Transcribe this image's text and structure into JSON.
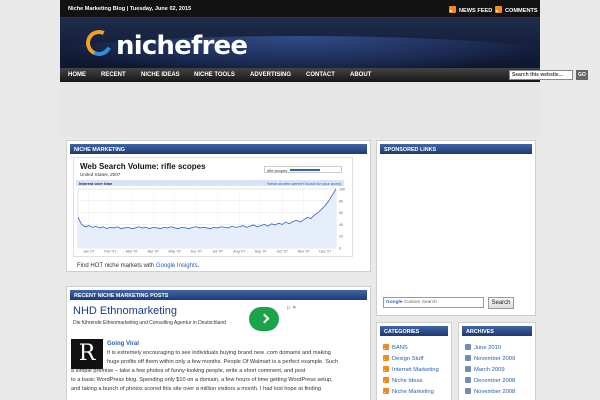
{
  "topbar": {
    "blog_date": "Niche Marketing Blog | Tuesday, June 02, 2015",
    "news_feed": "NEWS FEED",
    "comments": "COMMENTS"
  },
  "header": {
    "logo_text": "nichefree"
  },
  "nav": {
    "items": [
      "HOME",
      "RECENT",
      "NICHE IDEAS",
      "NICHE TOOLS",
      "ADVERTISING",
      "CONTACT",
      "ABOUT"
    ],
    "search_placeholder": "Search this website...",
    "go_label": "GO"
  },
  "niche_marketing": {
    "heading": "NICHE MARKETING",
    "chart_title": "Web Search Volume: rifle scopes",
    "chart_subtitle": "United States, 2007",
    "legend_term": "rifle scopes",
    "interest_label": "Interest over time",
    "news_headlines_label": "News stories weren't found for your query",
    "find_hot_prefix": "Find HOT niche markets with ",
    "find_hot_link": "Google Insights",
    "find_hot_suffix": "."
  },
  "chart_data": {
    "type": "line",
    "title": "Web Search Volume: rifle scopes",
    "subtitle": "United States, 2007",
    "series": [
      {
        "name": "rifle scopes",
        "values": [
          52,
          40,
          36,
          38,
          35,
          37,
          34,
          36,
          33,
          35,
          34,
          36,
          33,
          34,
          35,
          33,
          34,
          36,
          34,
          35,
          33,
          35,
          34,
          33,
          35,
          34,
          36,
          34,
          33,
          35,
          34,
          33,
          35,
          36,
          34,
          35,
          34,
          33,
          35,
          34,
          36,
          35,
          34,
          37,
          35,
          36,
          38,
          35,
          37,
          39,
          36,
          38,
          40,
          37,
          41,
          39,
          42,
          40,
          44,
          41,
          45,
          47,
          44,
          48,
          52,
          50,
          56,
          60,
          66,
          72,
          80,
          90,
          100
        ]
      }
    ],
    "categories": [
      "Jan '07",
      "Feb '07",
      "Mar '07",
      "Apr '07",
      "May '07",
      "Jun '07",
      "Jul '07",
      "Aug '07",
      "Sep '07",
      "Oct '07",
      "Nov '07",
      "Dec '07"
    ],
    "ylim": [
      0,
      100
    ],
    "yticks": [
      100,
      80,
      60,
      40,
      20,
      0
    ],
    "grid": true
  },
  "recent_posts": {
    "heading": "RECENT NICHE MARKETING POSTS",
    "ad_title": "NHD Ethnomarketing",
    "ad_desc": "Die führende Ethnomarketing und Consulting Agentur in Deutschland",
    "post_initial": "R",
    "post_title": "Going Viral",
    "post_lines": [
      "It is extremely encouraging to see individuals buying brand new .com domains and making",
      "huge profits off them within only a few months. People Of Walmart is a perfect example. Such",
      "a simple premise – take a few photos of funny-looking people, write a short comment, and post",
      "to a basic WordPress blog. Spending only $10 on a domain, a few hours of time getting WordPress setup,",
      "and taking a bunch of photos scored this site over a million visitors a month. I had lost hope at finding"
    ]
  },
  "sponsored": {
    "heading": "SPONSORED LINKS",
    "search_placeholder": "Custom Search",
    "google": "Google",
    "search_button": "Search"
  },
  "categories": {
    "heading": "CATEGORIES",
    "items": [
      "BANS",
      "Design Stuff",
      "Internet Marketing",
      "Niche Ideas",
      "Niche Marketing"
    ]
  },
  "archives": {
    "heading": "ARCHIVES",
    "items": [
      "June 2010",
      "November 2009",
      "March 2009",
      "December 2008",
      "November 2008"
    ]
  },
  "colors": {
    "accent": "#2a5db0",
    "header_bg": "#1a2444",
    "panel_head": "#2a4e8e",
    "rss": "#f28a1c",
    "line": "#2b66c8"
  }
}
